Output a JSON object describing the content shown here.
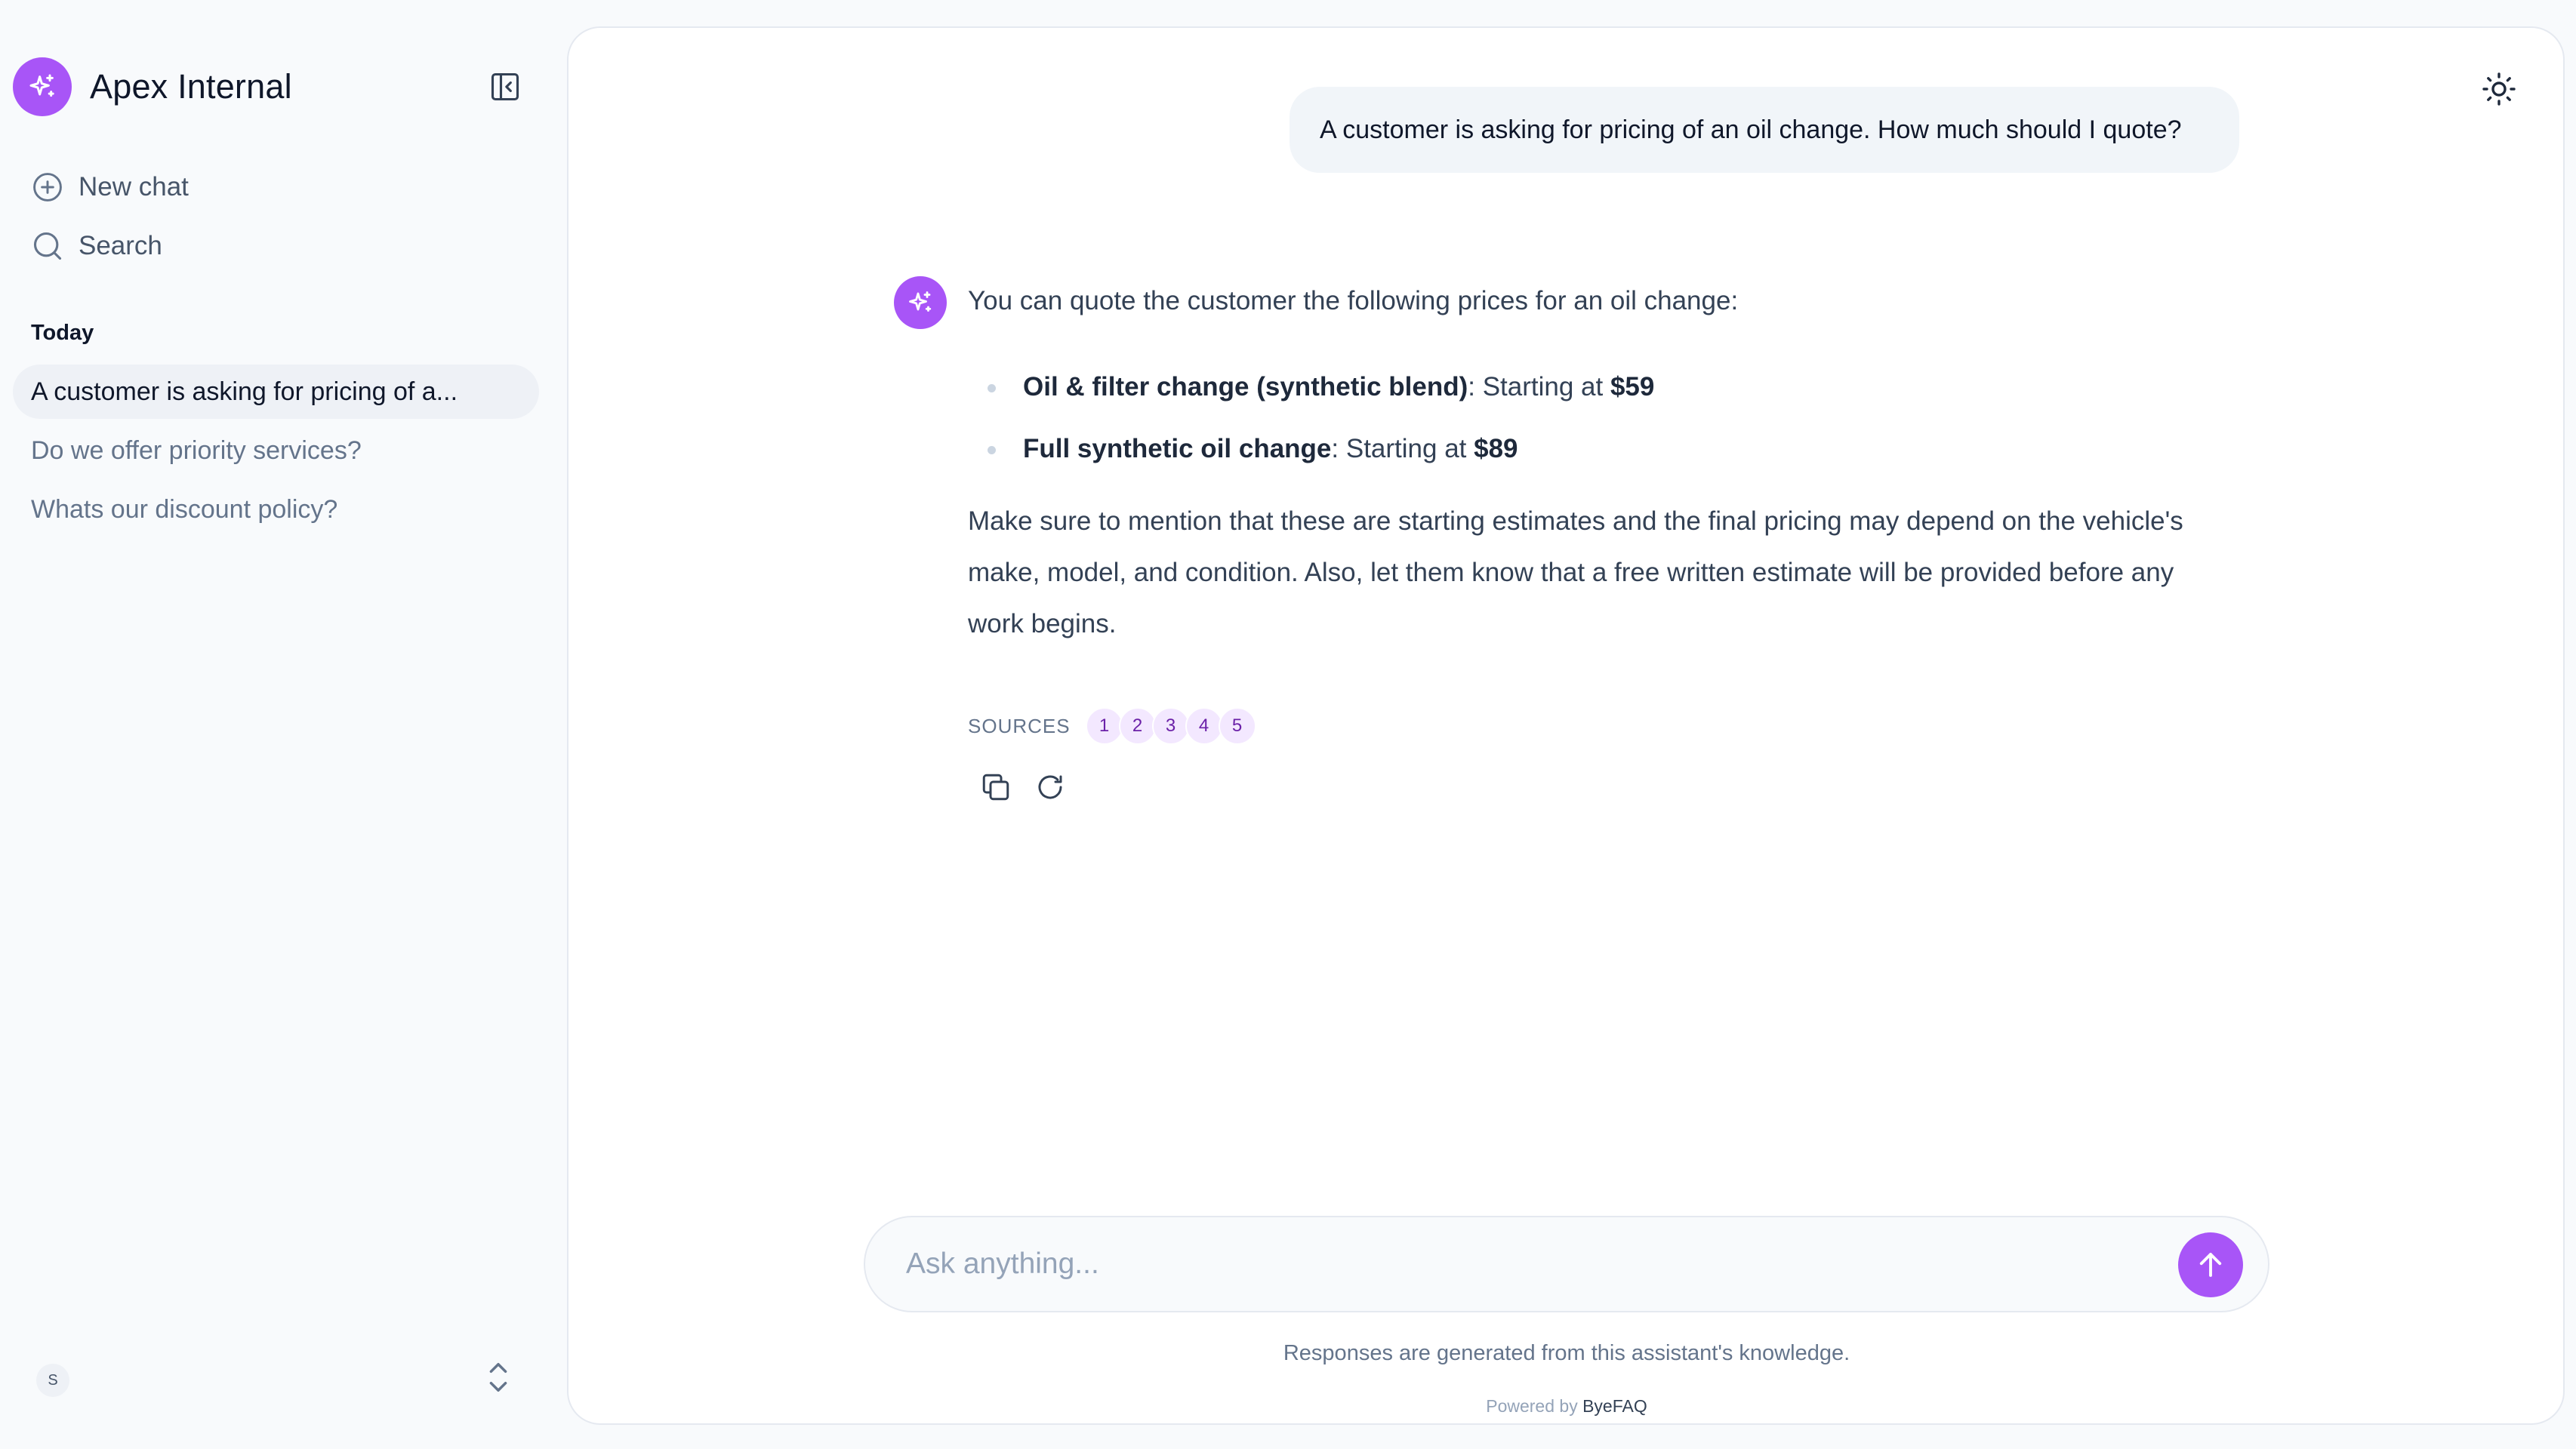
{
  "app": {
    "title": "Apex Internal",
    "accent_color": "#a855f7"
  },
  "sidebar": {
    "new_chat_label": "New chat",
    "search_label": "Search",
    "section_label": "Today",
    "history": [
      "A customer is asking for pricing of a...",
      "Do we offer priority services?",
      "Whats our discount policy?"
    ],
    "user_initial": "S"
  },
  "conversation": {
    "user_message": "A customer is asking for pricing of an oil change. How much should I quote?",
    "assistant": {
      "intro": "You can quote the customer the following prices for an oil change:",
      "items": [
        {
          "name": "Oil & filter change (synthetic blend)",
          "sep": ": Starting at ",
          "price": "$59"
        },
        {
          "name": "Full synthetic oil change",
          "sep": ": Starting at ",
          "price": "$89"
        }
      ],
      "paragraph": "Make sure to mention that these are starting estimates and the final pricing may depend on the vehicle's make, model, and condition. Also, let them know that a free written estimate will be provided before any work begins.",
      "sources_label": "SOURCES",
      "sources": [
        "1",
        "2",
        "3",
        "4",
        "5"
      ]
    }
  },
  "composer": {
    "placeholder": "Ask anything...",
    "disclaimer": "Responses are generated from this assistant's knowledge.",
    "powered_prefix": "Powered by ",
    "powered_brand": "ByeFAQ"
  },
  "icons": {
    "brand": "sparkles-icon",
    "collapse": "sidebar-collapse-icon",
    "new_chat": "plus-circle-icon",
    "search": "search-icon",
    "theme": "sun-icon",
    "copy": "copy-icon",
    "regenerate": "refresh-icon",
    "send": "arrow-up-icon",
    "user_menu": "chevrons-up-down-icon"
  }
}
